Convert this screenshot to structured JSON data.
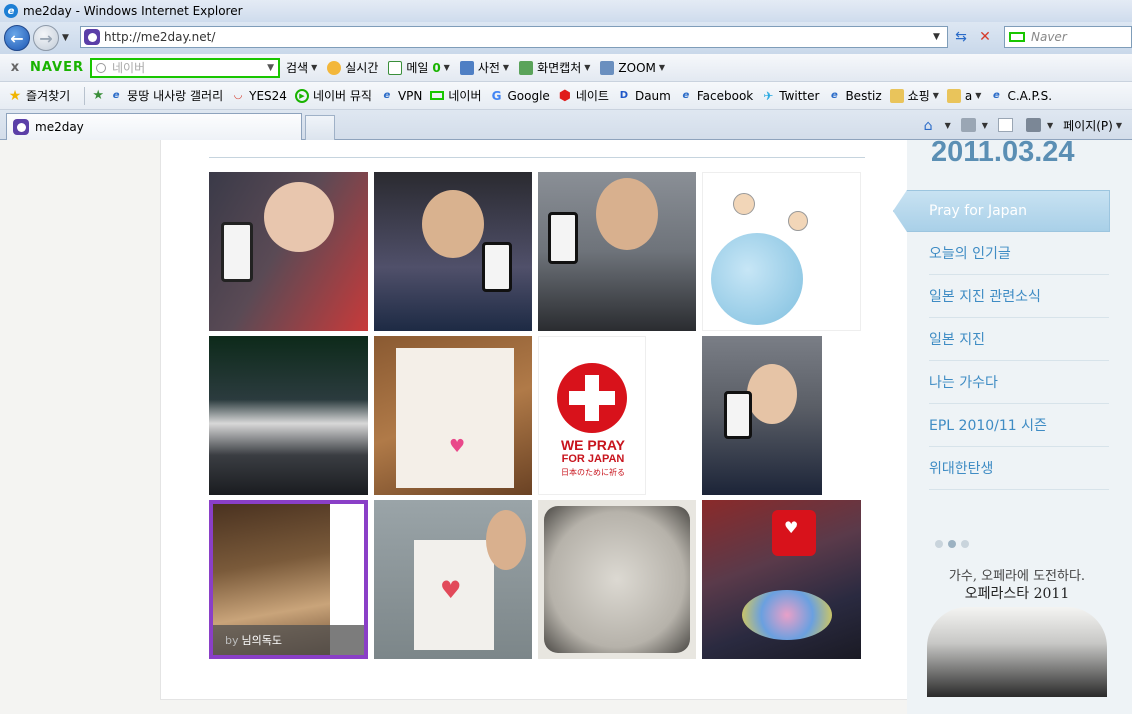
{
  "window": {
    "title": "me2day - Windows Internet Explorer"
  },
  "nav": {
    "url": "http://me2day.net/",
    "search_placeholder": "Naver"
  },
  "naver_toolbar": {
    "close": "x",
    "brand": "NAVER",
    "search_placeholder": "네이버",
    "items": [
      "검색",
      "실시간",
      "메일",
      "사전",
      "화면캡처",
      "ZOOM"
    ],
    "mail_count": "0"
  },
  "favorites": {
    "label": "즐겨찾기",
    "items": [
      "뭉땅 내사랑 갤러리",
      "YES24",
      "네이버 뮤직",
      "VPN",
      "네이버",
      "Google",
      "네이트",
      "Daum",
      "Facebook",
      "Twitter",
      "Bestiz",
      "쇼핑",
      "a",
      "C.A.P.S."
    ]
  },
  "tabs": {
    "active": "me2day"
  },
  "command_bar": {
    "page": "페이지(P)"
  },
  "photos": {
    "caption_by": "by",
    "caption_name": "님의독도",
    "red_cross_line1": "WE PRAY",
    "red_cross_line2": "FOR JAPAN",
    "red_cross_line3": "日本のために祈る"
  },
  "sidebar": {
    "date": "2011.03.24",
    "active": "Pray for Japan",
    "items": [
      "오늘의 인기글",
      "일본 지진 관련소식",
      "일본 지진",
      "나는 가수다",
      "EPL 2010/11 시즌",
      "위대한탄생"
    ],
    "banner_line1": "가수, 오페라에 도전하다.",
    "banner_line2": "오페라스타 2011"
  },
  "colors": {
    "accent": "#3f8cc4",
    "date": "#5b8fb4",
    "selected_border": "#8a3fc7",
    "naver_green": "#19b300"
  }
}
